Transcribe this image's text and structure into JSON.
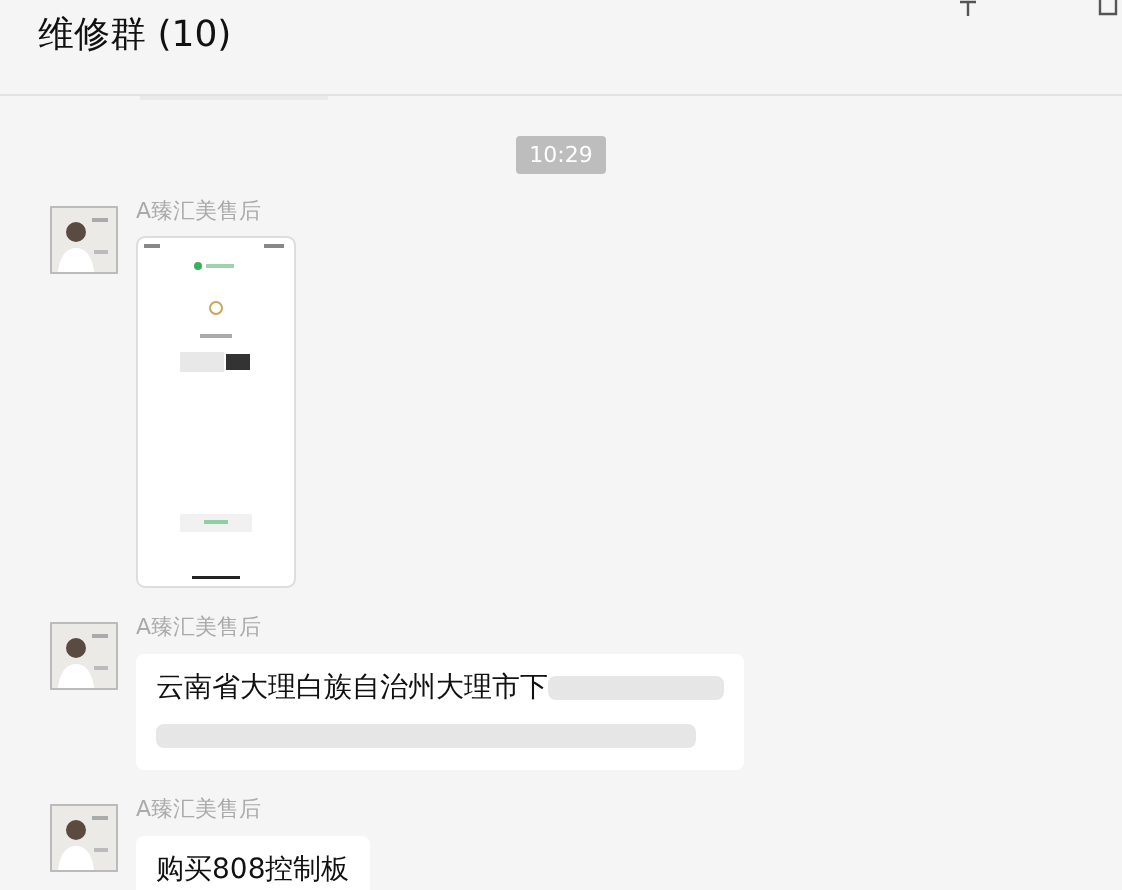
{
  "chat": {
    "title": "维修群 (10)"
  },
  "messages": [
    {
      "kind": "time",
      "text": "10:29"
    },
    {
      "sender": "A臻汇美售后"
    },
    {
      "kind": "text",
      "sender": "A臻汇美售后",
      "lines": [
        "云南省大理白族自治州大理市下"
      ],
      "redacted": true
    },
    {
      "kind": "text",
      "sender": "A臻汇美售后",
      "lines": [
        "购买808控制板"
      ],
      "redacted": false
    }
  ]
}
